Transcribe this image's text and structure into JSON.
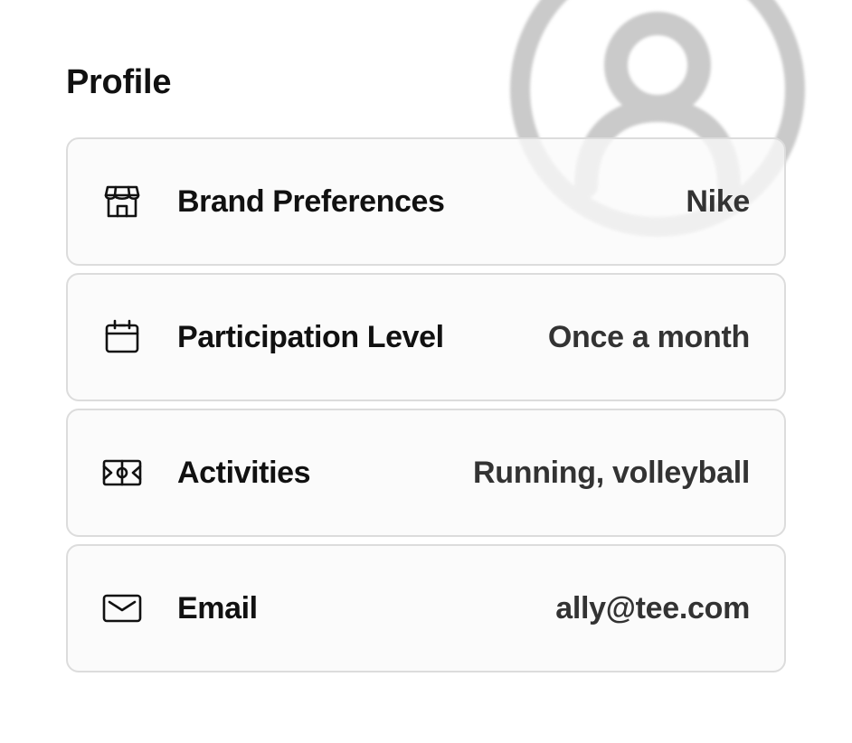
{
  "title": "Profile",
  "rows": [
    {
      "icon": "store-icon",
      "label": "Brand Preferences",
      "value": "Nike"
    },
    {
      "icon": "calendar-icon",
      "label": "Participation Level",
      "value": "Once a month"
    },
    {
      "icon": "court-icon",
      "label": "Activities",
      "value": "Running, volleyball"
    },
    {
      "icon": "mail-icon",
      "label": "Email",
      "value": "ally@tee.com"
    }
  ],
  "colors": {
    "text": "#111111",
    "value_text": "#333333",
    "card_border": "#dcdcdc",
    "card_bg": "#fafafa",
    "watermark": "#c9c9c9"
  },
  "avatar_icon": "user-circle-icon"
}
